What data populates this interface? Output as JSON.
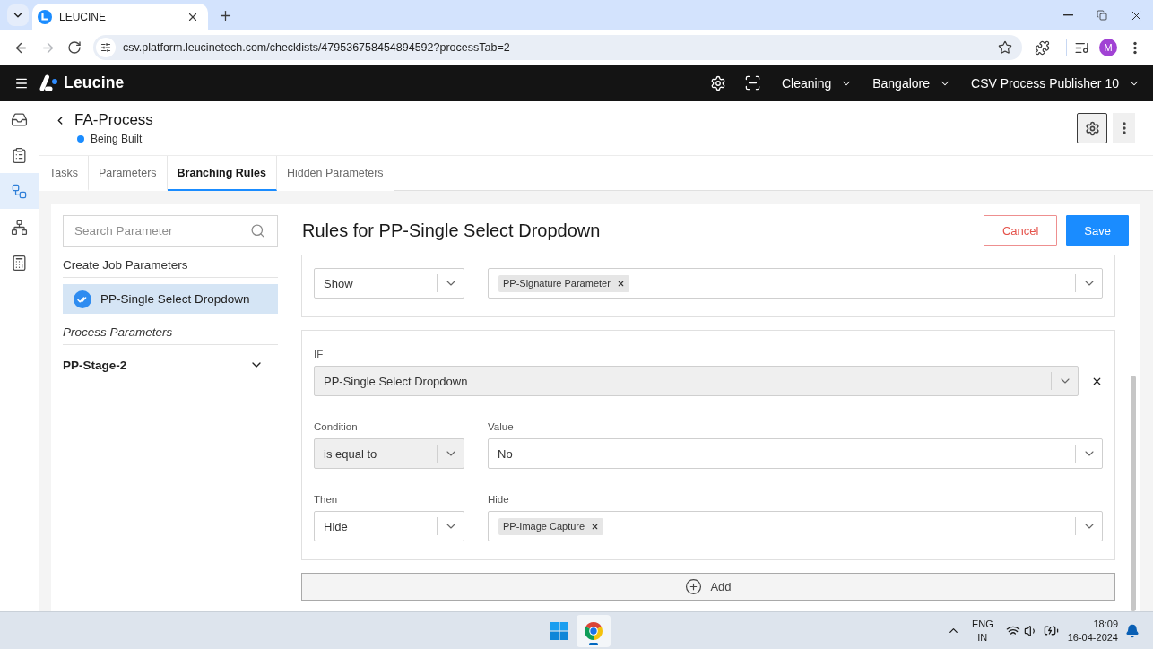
{
  "browser": {
    "tab": {
      "title": "LEUCINE"
    },
    "url": "csv.platform.leucinetech.com/checklists/479536758454894592?processTab=2",
    "forward_disabled": true,
    "profile_initial": "M"
  },
  "app_header": {
    "brand": "Leucine",
    "menus": [
      {
        "label": "Cleaning"
      },
      {
        "label": "Bangalore"
      },
      {
        "label": "CSV Process Publisher 10"
      }
    ]
  },
  "nav_rail": [
    {
      "kind": "inbox",
      "selected": false
    },
    {
      "kind": "checklist",
      "selected": false
    },
    {
      "kind": "flow",
      "selected": true
    },
    {
      "kind": "hierarchy",
      "selected": false
    },
    {
      "kind": "report",
      "selected": false
    }
  ],
  "process": {
    "title": "FA-Process",
    "status": "Being Built"
  },
  "tabs": [
    {
      "label": "Tasks",
      "selected": false
    },
    {
      "label": "Parameters",
      "selected": false
    },
    {
      "label": "Branching Rules",
      "selected": true
    },
    {
      "label": "Hidden Parameters",
      "selected": false
    }
  ],
  "sidebar": {
    "search": {
      "placeholder": "Search Parameter"
    },
    "create_job_parameters": {
      "title": "Create Job Parameters",
      "items": [
        {
          "label": "PP-Single Select Dropdown",
          "selected": true
        }
      ]
    },
    "process_parameters": {
      "title": "Process Parameters",
      "stages": [
        {
          "label": "PP-Stage-2",
          "expanded": false
        }
      ]
    }
  },
  "rules_panel": {
    "title": "Rules for PP-Single Select Dropdown",
    "buttons": [
      {
        "label": "Cancel",
        "kind": "secondary"
      },
      {
        "label": "Save",
        "kind": "primary"
      }
    ],
    "rules": [
      {
        "then": {
          "value": "Show",
          "disabled": false
        },
        "targets": {
          "chips": [
            {
              "label": "PP-Signature Parameter"
            }
          ]
        }
      },
      {
        "if": {
          "label": "IF",
          "value": "PP-Single Select Dropdown",
          "disabled": true
        },
        "condition": {
          "label": "Condition",
          "value": "is equal to",
          "disabled": true
        },
        "value": {
          "label": "Value",
          "value": "No",
          "disabled": false
        },
        "then": {
          "label": "Then",
          "value": "Hide",
          "disabled": false
        },
        "targets": {
          "label": "Hide",
          "chips": [
            {
              "label": "PP-Image Capture"
            }
          ]
        },
        "removable": true
      }
    ],
    "add_button": {
      "label": "Add"
    }
  },
  "taskbar": {
    "apps": [
      {
        "kind": "windows",
        "selected": false
      },
      {
        "kind": "chrome",
        "selected": true
      }
    ],
    "language": "ENG",
    "region": "IN",
    "time": "18:09",
    "date": "16-04-2024"
  }
}
